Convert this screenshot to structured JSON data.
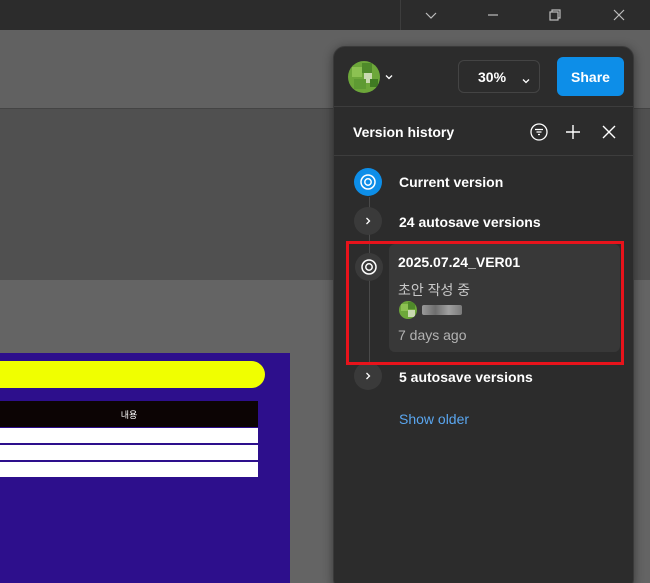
{
  "window": {
    "controls": [
      "chevron-down",
      "minimize",
      "restore",
      "close"
    ]
  },
  "canvas": {
    "frame": {
      "table_header": "내용",
      "pill_color": "#f0ff00",
      "frame_color": "#2d0f8c"
    }
  },
  "panel": {
    "zoom": "30%",
    "share_label": "Share",
    "title": "Version history",
    "items": [
      {
        "label": "Current version",
        "type": "current"
      },
      {
        "label": "24 autosave versions",
        "type": "group"
      },
      {
        "label": "2025.07.24_VER01",
        "type": "named",
        "description": "초안 작성 중",
        "time": "7 days ago"
      },
      {
        "label": "5 autosave versions",
        "type": "group"
      }
    ],
    "show_older": "Show older"
  },
  "colors": {
    "accent": "#0d8ee8",
    "highlight_box": "#e8131b",
    "link": "#5aa6ef"
  }
}
